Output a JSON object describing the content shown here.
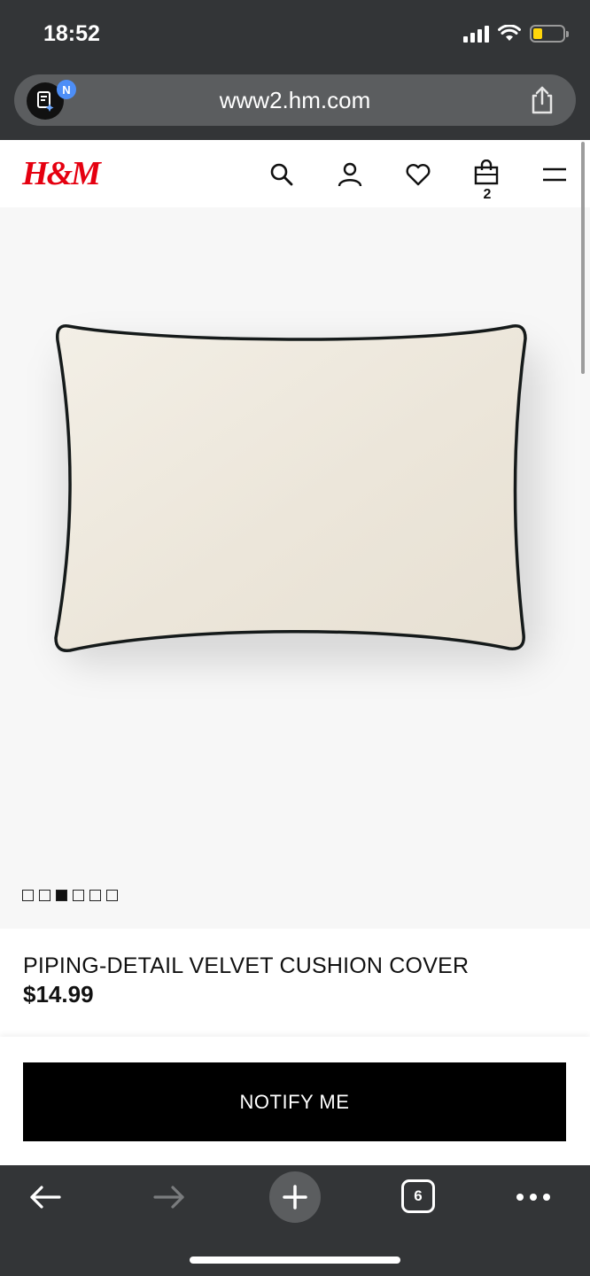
{
  "status_bar": {
    "time": "18:52"
  },
  "browser": {
    "url": "www2.hm.com",
    "badge": "N",
    "tabs_count": "6"
  },
  "header": {
    "logo": "H&M",
    "cart_count": "2",
    "icons": [
      "search-icon",
      "account-icon",
      "heart-icon",
      "bag-icon",
      "menu-icon"
    ]
  },
  "gallery": {
    "image_count": 6,
    "active_index": 2
  },
  "product": {
    "name": "PIPING-DETAIL VELVET CUSHION COVER",
    "price": "$14.99"
  },
  "actions": {
    "notify_label": "NOTIFY ME"
  },
  "toolbar": {
    "icons": [
      "back-arrow-icon",
      "forward-arrow-icon",
      "plus-icon",
      "tabs-icon",
      "more-icon"
    ]
  },
  "colors": {
    "brand_red": "#e50010",
    "button_black": "#000000",
    "chrome": "#333537"
  }
}
